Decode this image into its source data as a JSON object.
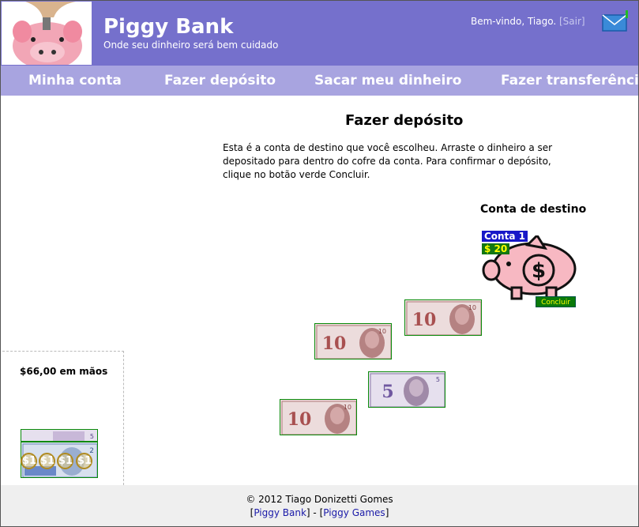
{
  "header": {
    "brand_title": "Piggy Bank",
    "brand_subtitle": "Onde seu dinheiro será bem cuidado",
    "welcome_text": "Bem-vindo, Tiago.",
    "logout_label": "Sair"
  },
  "nav": {
    "items": [
      "Minha conta",
      "Fazer depósito",
      "Sacar meu dinheiro",
      "Fazer transferência"
    ]
  },
  "main": {
    "title": "Fazer depósito",
    "intro": "Esta é a conta de destino que você escolheu. Arraste o dinheiro a ser depositado para dentro do cofre da conta. Para confirmar o depósito, clique no botão verde Concluir.",
    "destination_title": "Conta de destino",
    "account_name": "Conta 1",
    "account_balance": "$ 20",
    "confirm_button": "Concluir"
  },
  "bills": [
    {
      "value": "10",
      "color": "#d89a9a"
    },
    {
      "value": "10",
      "color": "#d89a9a"
    },
    {
      "value": "5",
      "color": "#b8a6d4"
    },
    {
      "value": "10",
      "color": "#d89a9a"
    }
  ],
  "wallet": {
    "label": "$66,00 em mãos",
    "bills": [
      "5",
      "2"
    ],
    "coins": [
      "$1",
      "$1",
      "$1",
      "$1"
    ]
  },
  "footer": {
    "copyright": "© 2012 Tiago Donizetti Gomes",
    "link1": "Piggy Bank",
    "link2": "Piggy Games"
  },
  "colors": {
    "header_bg": "#7570cc",
    "nav_bg": "#a8a4e0",
    "confirm_bg": "#0a7a0a",
    "account_badge": "#1818c8"
  }
}
